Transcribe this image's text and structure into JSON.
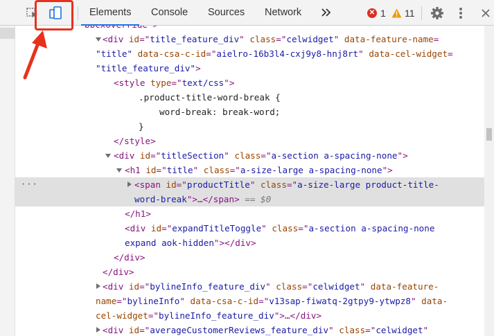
{
  "toolbar": {
    "tabs": [
      {
        "label": "Elements",
        "active": true
      },
      {
        "label": "Console",
        "active": false
      },
      {
        "label": "Sources",
        "active": false
      },
      {
        "label": "Network",
        "active": false
      }
    ],
    "more_tabs_icon": "double-chevron-right-icon",
    "errors": {
      "count": "1",
      "color": "#d93025"
    },
    "warnings": {
      "count": "11",
      "color": "#f29900"
    },
    "accent_color": "#1a73e8",
    "annotation_color": "#e8311c"
  },
  "tree": {
    "l0": {
      "t": "bbcxoverride\">"
    },
    "l1": {
      "a": "<div ",
      "b": "id",
      "c": "=\"",
      "d": "title_feature_div",
      "e": "\" ",
      "f": "class",
      "g": "=\"",
      "h": "celwidget",
      "i": "\" ",
      "j": "data-feature-name",
      "k": "="
    },
    "l2": {
      "a": "\"title\" ",
      "b": "data-csa-c-id",
      "c": "=\"",
      "d": "aielro-16b3l4-cxj9y8-hnj8rt",
      "e": "\" ",
      "f": "data-cel-widget",
      "g": "="
    },
    "l3": {
      "a": "\"title_feature_div\"",
      "b": ">"
    },
    "l4": {
      "a": "<style ",
      "b": "type",
      "c": "=\"",
      "d": "text/css",
      "e": "\">"
    },
    "l5": {
      "t": ".product-title-word-break {"
    },
    "l6": {
      "t": "word-break: break-word;"
    },
    "l7": {
      "t": "}"
    },
    "l8": {
      "t": "</style>"
    },
    "l9": {
      "a": "<div ",
      "b": "id",
      "c": "=\"",
      "d": "titleSection",
      "e": "\" ",
      "f": "class",
      "g": "=\"",
      "h": "a-section a-spacing-none",
      "i": "\">"
    },
    "l10": {
      "a": "<h1 ",
      "b": "id",
      "c": "=\"",
      "d": "title",
      "e": "\" ",
      "f": "class",
      "g": "=\"",
      "h": "a-size-large a-spacing-none",
      "i": "\">"
    },
    "l11": {
      "ell": "···",
      "a": "<span ",
      "b": "id",
      "c": "=\"",
      "d": "productTitle",
      "e": "\" ",
      "f": "class",
      "g": "=\"",
      "h": "a-size-large product-title-"
    },
    "l12": {
      "a": "word-break",
      "b": "\">…</span>",
      "c": " == $0"
    },
    "l13": {
      "t": "</h1>"
    },
    "l14": {
      "a": "<div ",
      "b": "id",
      "c": "=\"",
      "d": "expandTitleToggle",
      "e": "\" ",
      "f": "class",
      "g": "=\"",
      "h": "a-section a-spacing-none"
    },
    "l15": {
      "a": "expand aok-hidden",
      "b": "\"></div>"
    },
    "l16": {
      "t": "</div>"
    },
    "l17": {
      "t": "</div>"
    },
    "l18": {
      "a": "<div ",
      "b": "id",
      "c": "=\"",
      "d": "bylineInfo_feature_div",
      "e": "\" ",
      "f": "class",
      "g": "=\"",
      "h": "celwidget",
      "i": "\" ",
      "j": "data-feature-"
    },
    "l19": {
      "a": "name",
      "b": "=\"",
      "c": "bylineInfo",
      "d": "\" ",
      "e": "data-csa-c-id",
      "f": "=\"",
      "g": "v13sap-fiwatq-2gtpy9-ytwpz8",
      "h": "\" ",
      "i": "data-"
    },
    "l20": {
      "a": "cel-widget",
      "b": "=\"",
      "c": "bylineInfo_feature_div",
      "d": "\">…</div>"
    },
    "l21": {
      "a": "<div ",
      "b": "id",
      "c": "=\"",
      "d": "averageCustomerReviews_feature_div",
      "e": "\" ",
      "f": "class",
      "g": "=\"",
      "h": "celwidget",
      "i": "\""
    }
  }
}
